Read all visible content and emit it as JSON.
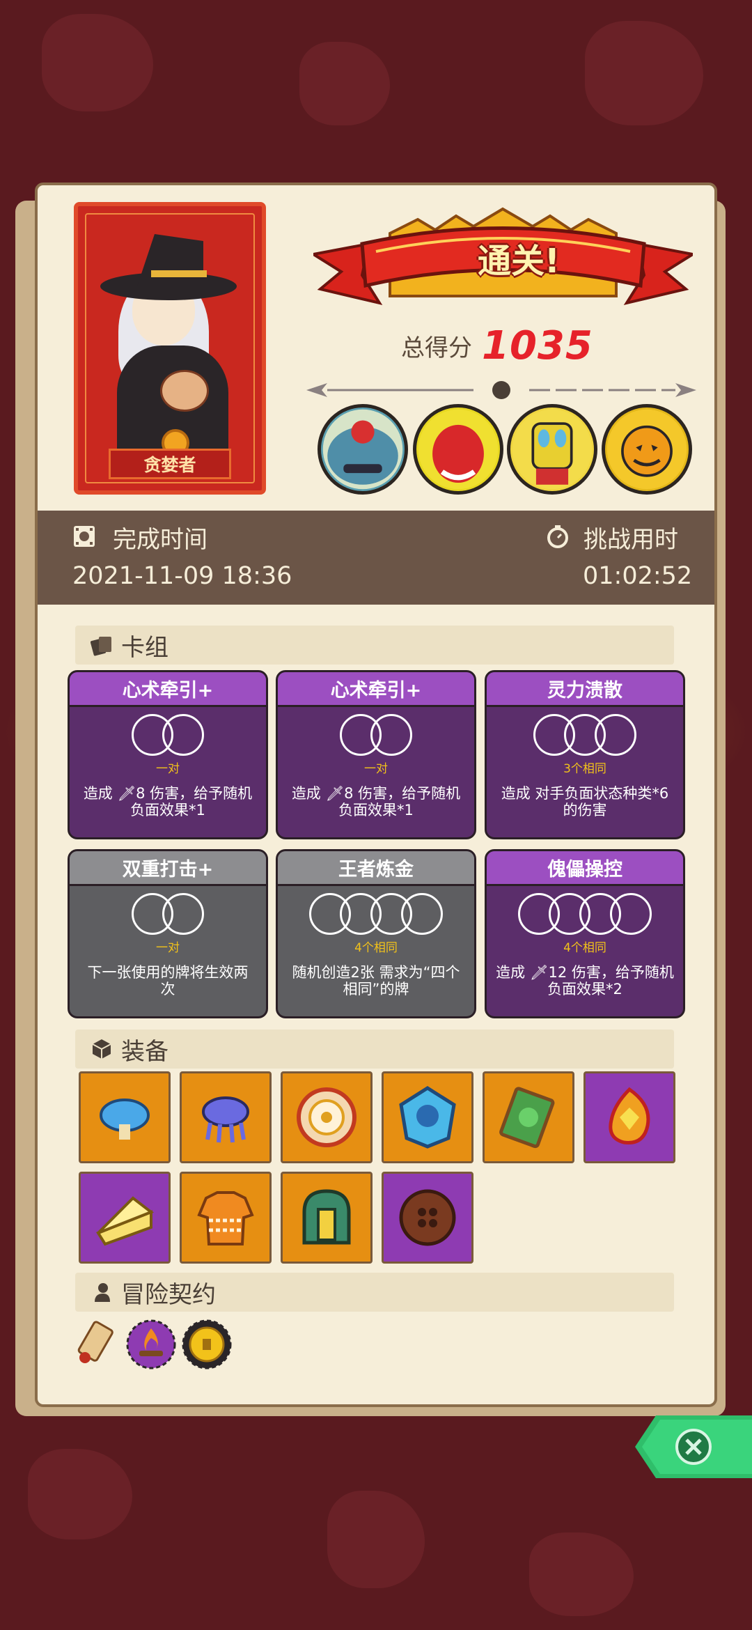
{
  "result": {
    "banner": "通关!",
    "score_label": "总得分",
    "score_value": "1035"
  },
  "character": {
    "name": "贪婪者"
  },
  "time": {
    "complete_label": "完成时间",
    "complete_value": "2021-11-09 18:36",
    "challenge_label": "挑战用时",
    "challenge_value": "01:02:52"
  },
  "sections": {
    "deck": "卡组",
    "equipment": "装备",
    "contract": "冒险契约"
  },
  "cards": [
    {
      "title": "心术牵引+",
      "slots": 2,
      "slot_caption": "一对",
      "desc_line1": "造成 🗡8 伤害，给予随机",
      "desc_line2": "负面效果*1",
      "color": "purple"
    },
    {
      "title": "心术牵引+",
      "slots": 2,
      "slot_caption": "一对",
      "desc_line1": "造成 🗡8 伤害，给予随机",
      "desc_line2": "负面效果*1",
      "color": "purple"
    },
    {
      "title": "灵力溃散",
      "slots": 3,
      "slot_caption": "3个相同",
      "desc_line1": "造成 对手负面状态种类*6",
      "desc_line2": "的伤害",
      "color": "purple"
    },
    {
      "title": "双重打击+",
      "slots": 2,
      "slot_caption": "一对",
      "desc_line1": "下一张使用的牌将生效两",
      "desc_line2": "次",
      "color": "gray"
    },
    {
      "title": "王者炼金",
      "slots": 4,
      "slot_caption": "4个相同",
      "desc_line1": "随机创造2张 需求为“四个",
      "desc_line2": "相同”的牌",
      "color": "gray"
    },
    {
      "title": "傀儡操控",
      "slots": 4,
      "slot_caption": "4个相同",
      "desc_line1": "造成 🗡12 伤害，给予随机",
      "desc_line2": "负面效果*2",
      "color": "purple"
    }
  ],
  "equipment": [
    {
      "icon": "blue-mushroom-icon",
      "bg": "orange"
    },
    {
      "icon": "jellyfish-icon",
      "bg": "orange"
    },
    {
      "icon": "shield-ring-icon",
      "bg": "orange"
    },
    {
      "icon": "blue-gem-icon",
      "bg": "orange"
    },
    {
      "icon": "green-book-icon",
      "bg": "orange"
    },
    {
      "icon": "fire-gem-icon",
      "bg": "purple"
    },
    {
      "icon": "cheese-icon",
      "bg": "purple"
    },
    {
      "icon": "sweater-icon",
      "bg": "orange"
    },
    {
      "icon": "helmet-icon",
      "bg": "orange"
    },
    {
      "icon": "button-icon",
      "bg": "purple"
    }
  ],
  "contracts": [
    "scroll-icon",
    "campfire-icon",
    "gold-coin-icon"
  ],
  "bosses": [
    "blue-monster-icon",
    "red-demon-icon",
    "skull-mask-icon",
    "pumpkin-icon"
  ],
  "colors": {
    "panel": "#f6eed9",
    "accent_red": "#e6222a",
    "card_purple": "#9c4fc1",
    "card_gray": "#8d8d90",
    "equip_orange": "#e68f12",
    "equip_purple": "#8e3bb2"
  }
}
